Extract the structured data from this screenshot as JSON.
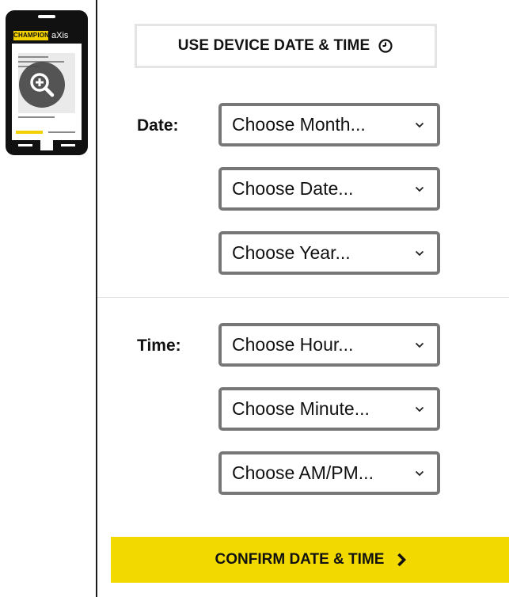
{
  "thumbnail": {
    "brand_primary": "CHAMPION",
    "brand_secondary": "aXis",
    "icon": "zoom-in-icon"
  },
  "header": {
    "device_button_label": "USE DEVICE DATE & TIME",
    "device_button_icon": "clock-icon"
  },
  "date": {
    "label": "Date:",
    "month_placeholder": "Choose Month...",
    "day_placeholder": "Choose Date...",
    "year_placeholder": "Choose Year..."
  },
  "time": {
    "label": "Time:",
    "hour_placeholder": "Choose Hour...",
    "minute_placeholder": "Choose Minute...",
    "ampm_placeholder": "Choose AM/PM..."
  },
  "footer": {
    "confirm_label": "CONFIRM DATE & TIME",
    "confirm_icon": "chevron-right-icon"
  },
  "colors": {
    "accent_yellow": "#f2d900",
    "select_border": "#777777",
    "text": "#111111"
  }
}
